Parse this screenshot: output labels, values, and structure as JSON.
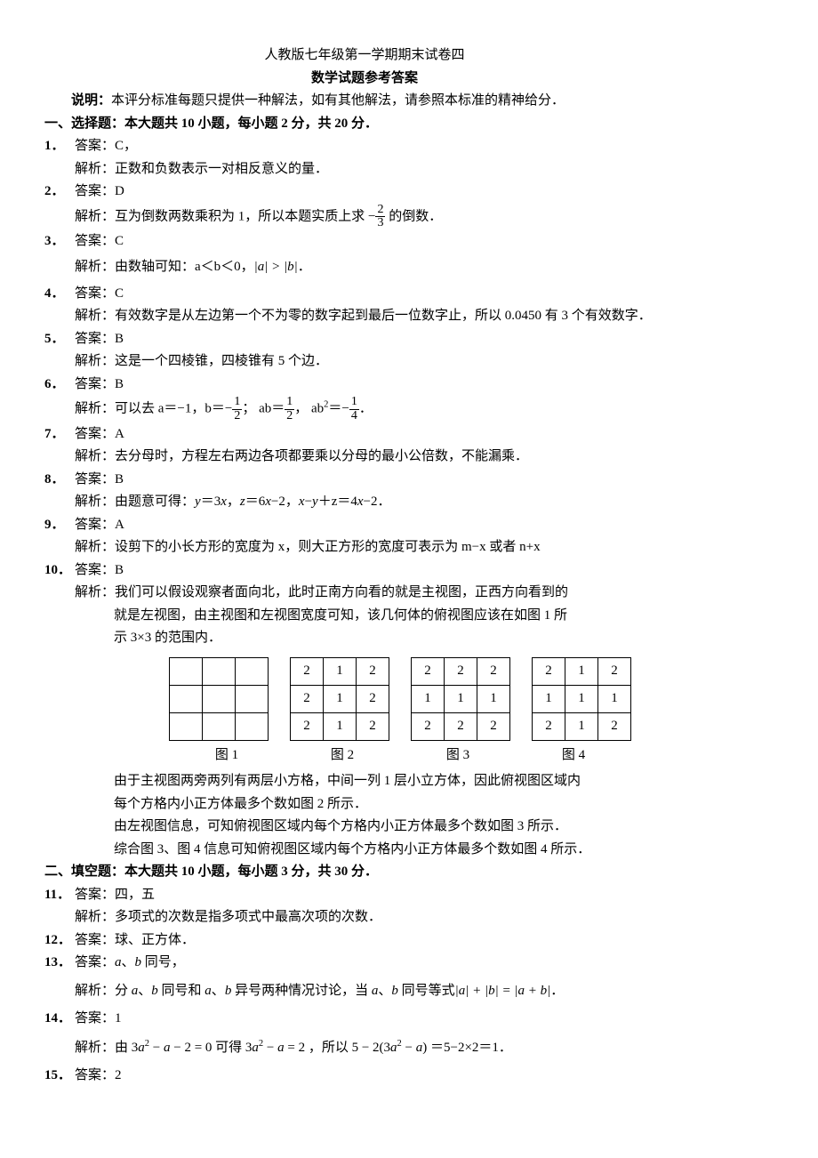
{
  "header": {
    "title1": "人教版七年级第一学期期末试卷四",
    "title2": "数学试题参考答案",
    "note": "说明：本评分标准每题只提供一种解法，如有其他解法，请参照本标准的精神给分．"
  },
  "section1": {
    "heading": "一、选择题：本大题共 10 小题，每小题 2 分，共 20 分．"
  },
  "q1": {
    "n": "1．",
    "a": "答案：C，",
    "e": "解析：正数和负数表示一对相反意义的量．"
  },
  "q2": {
    "n": "2．",
    "a": "答案：D",
    "ep": "解析：互为倒数两数乘积为 1，所以本题实质上求 −",
    "es": " 的倒数．",
    "ft": "2",
    "fb": "3"
  },
  "q3": {
    "n": "3．",
    "a": "答案：C",
    "ep": "解析：由数轴可知：a＜b＜0，",
    "mid": "|a| > |b|",
    "es": "．"
  },
  "q4": {
    "n": "4．",
    "a": "答案：C",
    "e": "解析：有效数字是从左边第一个不为零的数字起到最后一位数字止，所以 0.0450 有 3  个有效数字．"
  },
  "q5": {
    "n": "5．",
    "a": "答案：B",
    "e": "解析：这是一个四棱锥，四棱锥有 5 个边．"
  },
  "q6": {
    "n": "6．",
    "a": "答案：B",
    "p1": "解析：可以去 a＝−1，b＝−",
    "p2": "； ab＝",
    "p3": "， ab",
    "p4": "＝−",
    "p5": "．",
    "f1t": "1",
    "f1b": "2",
    "f2t": "1",
    "f2b": "2",
    "f3t": "1",
    "f3b": "4"
  },
  "q7": {
    "n": "7．",
    "a": "答案：A",
    "e": "解析：去分母时，方程左右两边各项都要乘以分母的最小公倍数，不能漏乘．"
  },
  "q8": {
    "n": "8．",
    "a": "答案：B",
    "e": "解析：由题意可得：y＝3x，z＝6x−2，x−y＋z＝4x−2．"
  },
  "q9": {
    "n": "9．",
    "a": "答案：A",
    "e": "解析：设剪下的小长方形的宽度为 x，则大正方形的宽度可表示为 m−x 或者 n+x"
  },
  "q10": {
    "n": "10．",
    "a": "答案：B",
    "e1": "解析：我们可以假设观察者面向北，此时正南方向看的就是主视图，正西方向看到的",
    "e2": "就是左视图，由主视图和左视图宽度可知，该几何体的俯视图应该在如图 1 所",
    "e3": "示 3×3 的范围内．",
    "p1": "由于主视图两旁两列有两层小方格，中间一列 1 层小立方体，因此俯视图区域内",
    "p2": "每个方格内小正方体最多个数如图 2 所示．",
    "p3": "由左视图信息，可知俯视图区域内每个方格内小正方体最多个数如图 3 所示．",
    "p4": "综合图 3、图 4 信息可知俯视图区域内每个方格内小正方体最多个数如图 4 所示．"
  },
  "grids": {
    "g1": [
      [
        "",
        "",
        ""
      ],
      [
        "",
        "",
        ""
      ],
      [
        "",
        "",
        ""
      ]
    ],
    "g2": [
      [
        "2",
        "1",
        "2"
      ],
      [
        "2",
        "1",
        "2"
      ],
      [
        "2",
        "1",
        "2"
      ]
    ],
    "g3": [
      [
        "2",
        "2",
        "2"
      ],
      [
        "1",
        "1",
        "1"
      ],
      [
        "2",
        "2",
        "2"
      ]
    ],
    "g4": [
      [
        "2",
        "1",
        "2"
      ],
      [
        "1",
        "1",
        "1"
      ],
      [
        "2",
        "1",
        "2"
      ]
    ],
    "c1": "图 1",
    "c2": "图 2",
    "c3": "图 3",
    "c4": "图 4"
  },
  "section2": {
    "heading": "二、填空题：本大题共 10 小题，每小题 3 分，共 30 分．"
  },
  "q11": {
    "n": "11．",
    "a": "答案：四，五",
    "e": "解析：多项式的次数是指多项式中最高次项的次数．"
  },
  "q12": {
    "n": "12．",
    "a": "答案：球、正方体．"
  },
  "q13": {
    "n": "13．",
    "a": "答案：a、b 同号，",
    "ep": "解析：分 a、b 同号和 a、b 异号两种情况讨论，当 a、b 同号等式",
    "mid": "|a| + |b| = |a + b|",
    "es": "．"
  },
  "q14": {
    "n": "14．",
    "a": "答案：1",
    "ep": "解析：由 3a",
    "ep2": " − a − 2 = 0 可得 3a",
    "ep3": " − a = 2 ，所以 5 − 2(3a",
    "ep4": " − a) ＝5−2×2＝1．"
  },
  "q15": {
    "n": "15．",
    "a": "答案：2"
  }
}
